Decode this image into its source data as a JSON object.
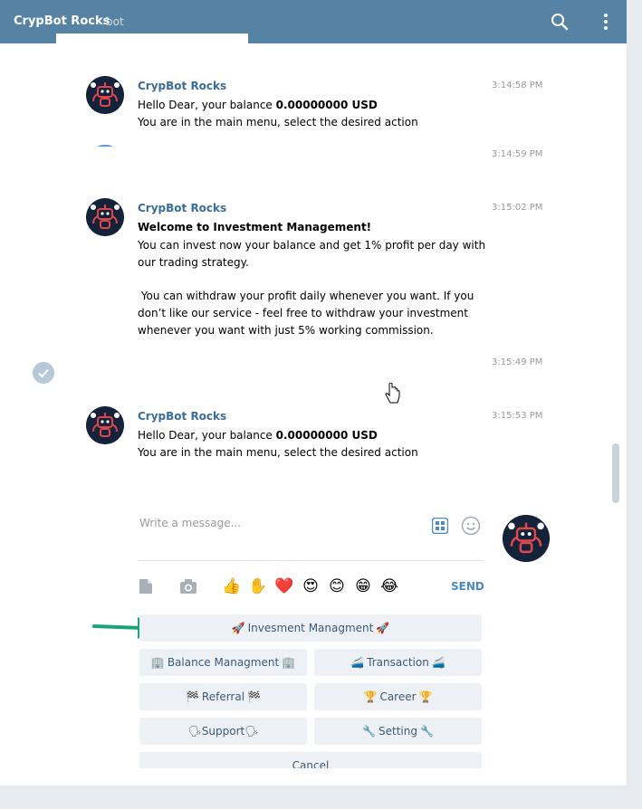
{
  "header": {
    "title": "CrypBot Rocks",
    "subtitle": "bot"
  },
  "messages": [
    {
      "name": "CrypBot Rocks",
      "time": "3:14:58 PM",
      "line1_pre": "Hello Dear, your balance ",
      "line1_bold": "0.00000000 USD",
      "line2": "You are in the main menu, select the desired action"
    },
    {
      "time": "3:14:59 PM"
    },
    {
      "name": "CrypBot Rocks",
      "time": "3:15:02 PM",
      "heading": "Welcome to Investment Management!",
      "lines": [
        "You can invest now your balance and get 1% profit per day with",
        "our trading strategy.",
        " You can withdraw your profit daily whenever you want. If you",
        "don’t like our service - feel free to withdraw your investment",
        "whenever you want with just 5% working commission."
      ]
    },
    {
      "time": "3:15:49 PM"
    },
    {
      "name": "CrypBot Rocks",
      "time": "3:15:53 PM",
      "line1_pre": "Hello Dear, your balance ",
      "line1_bold": "0.00000000 USD",
      "line2": "You are in the main menu, select the desired action"
    }
  ],
  "composer": {
    "placeholder": "Write a message..."
  },
  "toolbar": {
    "emojis": [
      "👍",
      "✋",
      "❤️",
      "😍",
      "😊",
      "😁",
      "😂"
    ],
    "send_label": "SEND"
  },
  "keyboard": {
    "investment": {
      "left": "🚀",
      "label": "Invesment Managment",
      "right": "🚀"
    },
    "balance": {
      "left": "🏢",
      "label": "Balance Managment",
      "right": "🏢"
    },
    "transaction": {
      "left": "🚄",
      "label": "Transaction",
      "right": "🚄"
    },
    "referral": {
      "left": "🏁",
      "label": "Referral",
      "right": "🏁"
    },
    "career": {
      "left": "🏆",
      "label": "Career",
      "right": "🏆"
    },
    "support": {
      "left": "🗣",
      "label": "Support",
      "right": "🗣"
    },
    "setting": {
      "left": "🔧",
      "label": "Setting",
      "right": "🔧"
    },
    "cancel": "Cancel"
  },
  "colors": {
    "header": "#5682a3",
    "accent": "#4b8bc2",
    "button_bg": "#edf1f5",
    "arrow": "#1aa37a"
  }
}
